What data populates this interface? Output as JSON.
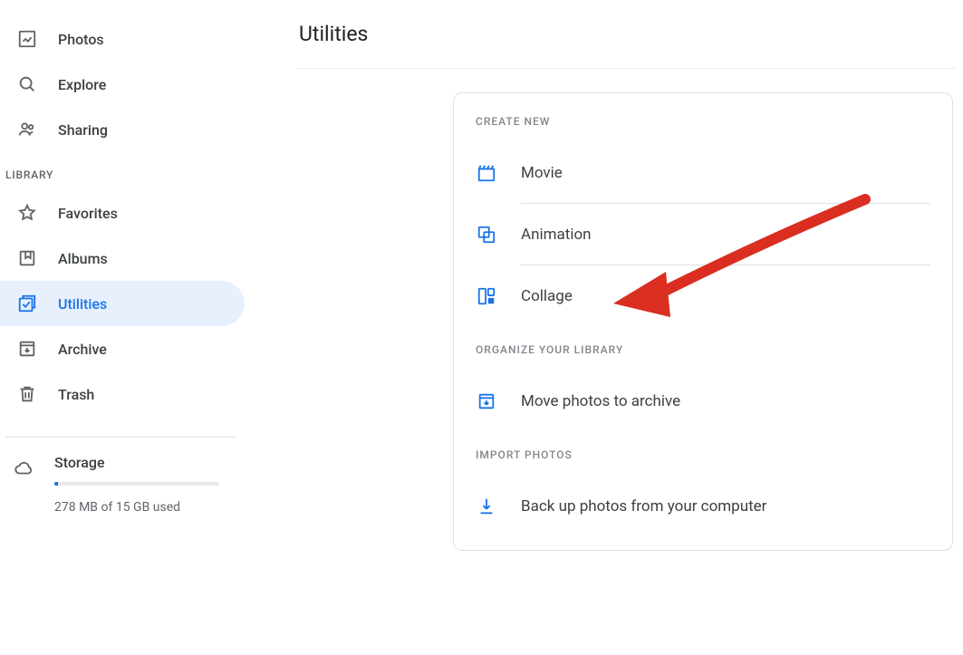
{
  "sidebar": {
    "nav_top": [
      {
        "label": "Photos",
        "icon": "image-icon"
      },
      {
        "label": "Explore",
        "icon": "search-icon"
      },
      {
        "label": "Sharing",
        "icon": "people-icon"
      }
    ],
    "library_header": "LIBRARY",
    "nav_library": [
      {
        "label": "Favorites",
        "icon": "star-icon",
        "active": false
      },
      {
        "label": "Albums",
        "icon": "bookmark-icon",
        "active": false
      },
      {
        "label": "Utilities",
        "icon": "utilities-icon",
        "active": true
      },
      {
        "label": "Archive",
        "icon": "archive-icon",
        "active": false
      },
      {
        "label": "Trash",
        "icon": "trash-icon",
        "active": false
      }
    ],
    "storage": {
      "title": "Storage",
      "used_text": "278 MB of 15 GB used",
      "percent": 1.8
    }
  },
  "main": {
    "title": "Utilities",
    "card": {
      "create_new_header": "CREATE NEW",
      "create_items": [
        {
          "label": "Movie",
          "icon": "movie-icon"
        },
        {
          "label": "Animation",
          "icon": "animation-icon"
        },
        {
          "label": "Collage",
          "icon": "collage-icon"
        }
      ],
      "organize_header": "ORGANIZE YOUR LIBRARY",
      "organize_items": [
        {
          "label": "Move photos to archive",
          "icon": "archive-box-icon"
        }
      ],
      "import_header": "IMPORT PHOTOS",
      "import_items": [
        {
          "label": "Back up photos from your computer",
          "icon": "download-icon"
        }
      ]
    }
  },
  "annotation": {
    "arrow_color": "#d92e20",
    "arrow_target": "collage"
  }
}
